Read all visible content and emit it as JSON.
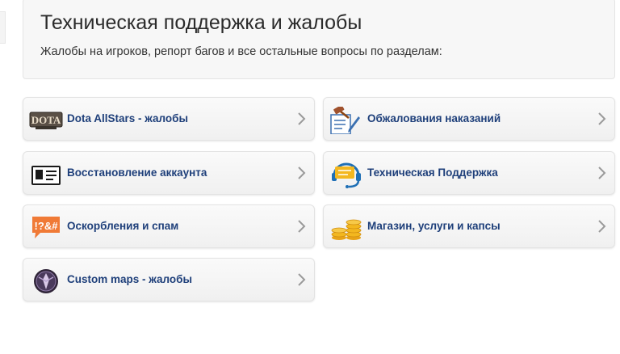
{
  "header": {
    "title": "Техническая поддержка и жалобы",
    "subtitle": "Жалобы на игроков, репорт багов и все остальные вопросы по разделам:"
  },
  "categories": [
    {
      "label": "Dota AllStars - жалобы",
      "icon": "dota-logo-icon"
    },
    {
      "label": "Обжалования наказаний",
      "icon": "gavel-icon"
    },
    {
      "label": "Восстановление аккаунта",
      "icon": "id-card-icon"
    },
    {
      "label": "Техническая Поддержка",
      "icon": "headset-icon"
    },
    {
      "label": "Оскорбления и спам",
      "icon": "swear-bubble-icon"
    },
    {
      "label": "Магазин, услуги и капсы",
      "icon": "coins-icon"
    },
    {
      "label": "Custom maps - жалобы",
      "icon": "custom-maps-emblem-icon"
    }
  ],
  "colors": {
    "link": "#1e3f7a",
    "chevron": "#9a9a9a"
  }
}
